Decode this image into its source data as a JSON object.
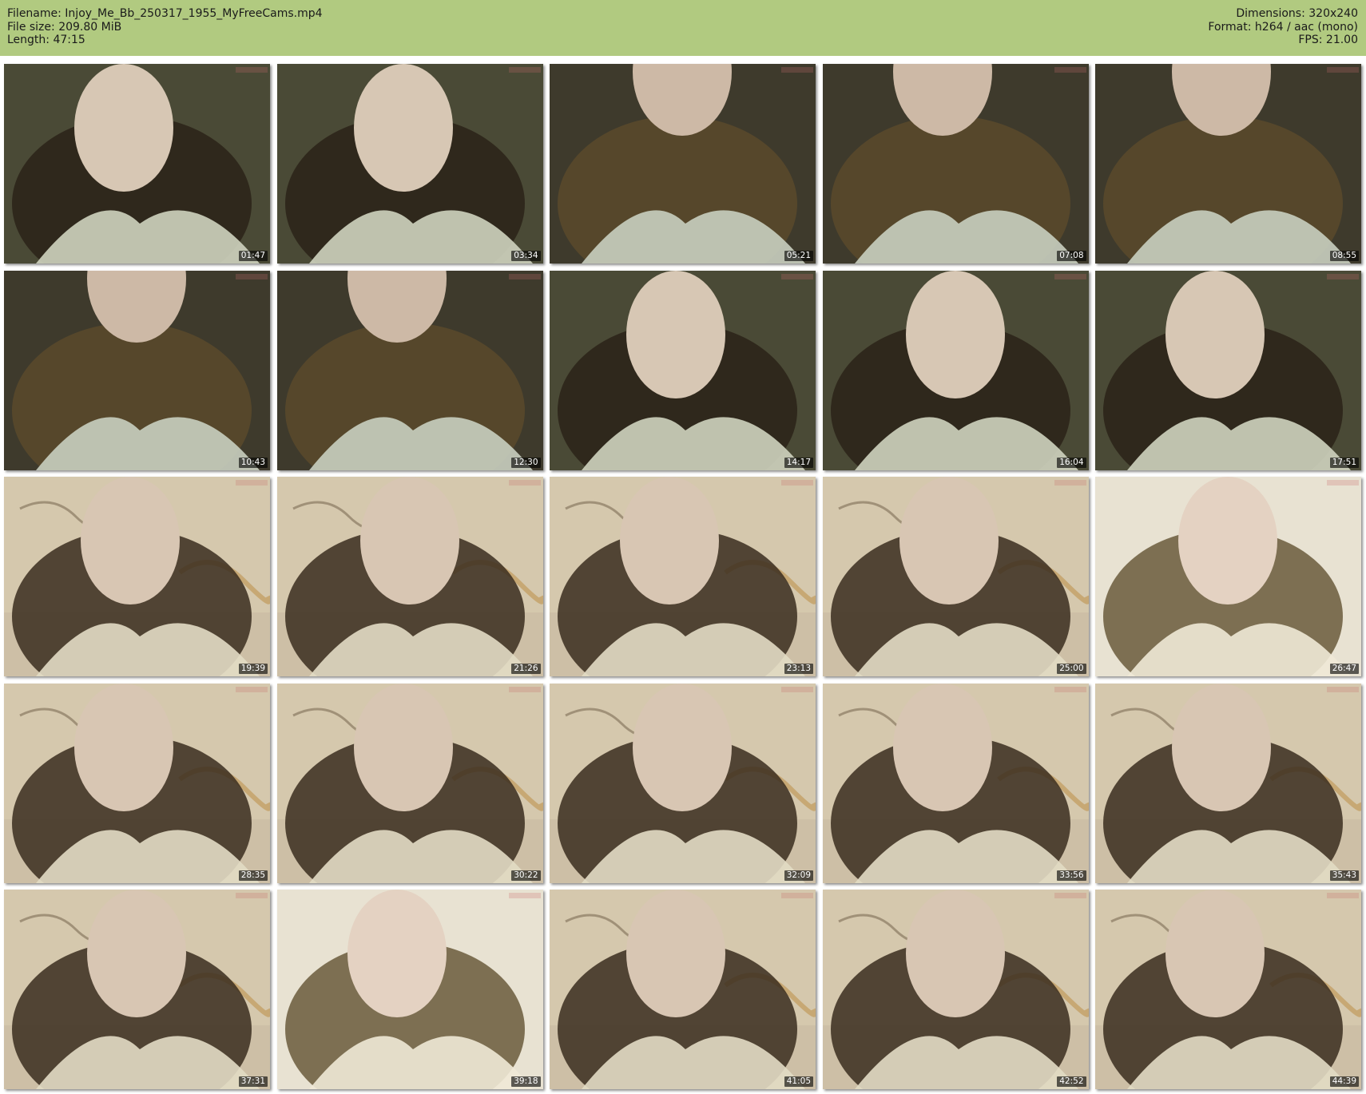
{
  "header": {
    "filename": "Filename: Injoy_Me_Bb_250317_1955_MyFreeCams.mp4",
    "filesize": "File size: 209.80 MiB",
    "length": "Length: 47:15",
    "dimensions": "Dimensions: 320x240",
    "format": "Format: h264 / aac (mono)",
    "fps": "FPS: 21.00"
  },
  "thumbnails": [
    {
      "time": "01:47",
      "scene": "face"
    },
    {
      "time": "03:34",
      "scene": "face"
    },
    {
      "time": "05:21",
      "scene": "hair"
    },
    {
      "time": "07:08",
      "scene": "hair"
    },
    {
      "time": "08:55",
      "scene": "hair"
    },
    {
      "time": "10:43",
      "scene": "hair"
    },
    {
      "time": "12:30",
      "scene": "hair"
    },
    {
      "time": "14:17",
      "scene": "face"
    },
    {
      "time": "16:04",
      "scene": "face"
    },
    {
      "time": "17:51",
      "scene": "face"
    },
    {
      "time": "19:39",
      "scene": "map"
    },
    {
      "time": "21:26",
      "scene": "map"
    },
    {
      "time": "23:13",
      "scene": "map"
    },
    {
      "time": "25:00",
      "scene": "map"
    },
    {
      "time": "26:47",
      "scene": "bright"
    },
    {
      "time": "28:35",
      "scene": "map"
    },
    {
      "time": "30:22",
      "scene": "map"
    },
    {
      "time": "32:09",
      "scene": "map"
    },
    {
      "time": "33:56",
      "scene": "map"
    },
    {
      "time": "35:43",
      "scene": "map"
    },
    {
      "time": "37:31",
      "scene": "map"
    },
    {
      "time": "39:18",
      "scene": "bright"
    },
    {
      "time": "41:05",
      "scene": "map"
    },
    {
      "time": "42:52",
      "scene": "map"
    },
    {
      "time": "44:39",
      "scene": "map"
    }
  ],
  "colors": {
    "header_bg": "#b1ca80",
    "timestamp_bg": "#000000",
    "timestamp_text": "#ffffff"
  }
}
